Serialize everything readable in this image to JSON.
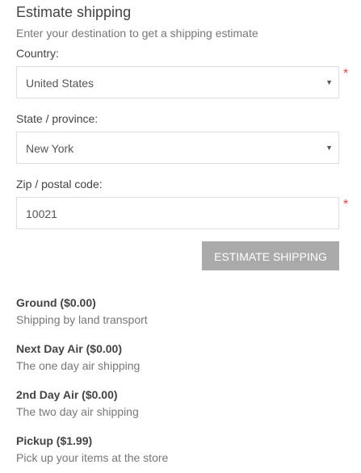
{
  "heading": {
    "title": "Estimate shipping",
    "subtitle": "Enter your destination to get a shipping estimate"
  },
  "form": {
    "country": {
      "label": "Country:",
      "value": "United States",
      "required_mark": "*"
    },
    "state": {
      "label": "State / province:",
      "value": "New York"
    },
    "zip": {
      "label": "Zip / postal code:",
      "value": "10021",
      "required_mark": "*"
    },
    "estimate_button": "ESTIMATE SHIPPING"
  },
  "options": [
    {
      "name": "Ground ($0.00)",
      "description": "Shipping by land transport"
    },
    {
      "name": "Next Day Air ($0.00)",
      "description": "The one day air shipping"
    },
    {
      "name": "2nd Day Air ($0.00)",
      "description": "The two day air shipping"
    },
    {
      "name": "Pickup ($1.99)",
      "description": "Pick up your items at the store"
    }
  ],
  "colors": {
    "button_bg": "#aaaaaa",
    "required": "#e4434b",
    "border": "#dddddd"
  }
}
